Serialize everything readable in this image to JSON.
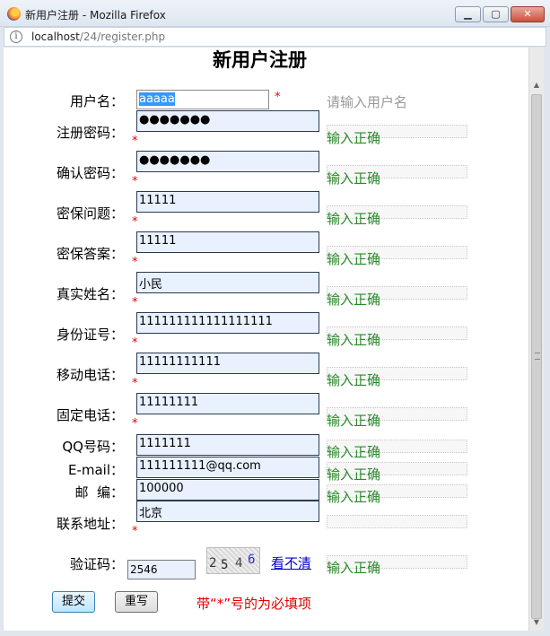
{
  "window": {
    "title": "新用户注册 - Mozilla Firefox",
    "minimize": "▁",
    "maximize": "▢",
    "close": "✕"
  },
  "address": {
    "host": "localhost",
    "path": "/24/register.php"
  },
  "page": {
    "title": "新用户注册",
    "star": "*",
    "ok": "输入正确",
    "rows": [
      {
        "label": "用户名：",
        "value": "aaaaa",
        "hint": "请输入用户名"
      },
      {
        "label": "注册密码：",
        "value": "●●●●●●●"
      },
      {
        "label": "确认密码：",
        "value": "●●●●●●●"
      },
      {
        "label": "密保问题：",
        "value": "11111"
      },
      {
        "label": "密保答案：",
        "value": "11111"
      },
      {
        "label": "真实姓名：",
        "value": "小民"
      },
      {
        "label": "身份证号：",
        "value": "111111111111111111"
      },
      {
        "label": "移动电话：",
        "value": "11111111111"
      },
      {
        "label": "固定电话：",
        "value": "11111111"
      },
      {
        "label": "QQ号码：",
        "value": "1111111"
      },
      {
        "label": "E-mail：",
        "value": "111111111@qq.com"
      },
      {
        "label": "邮  编：",
        "value": "100000"
      },
      {
        "label": "联系地址：",
        "value": "北京"
      }
    ],
    "captcha": {
      "label": "验证码：",
      "value": "2546",
      "digits": [
        "2",
        "5",
        "4",
        "6"
      ],
      "refresh_label": "看不清"
    },
    "submit_label": "提交",
    "reset_label": "重写",
    "required_note": "带“*”号的为必填项"
  }
}
